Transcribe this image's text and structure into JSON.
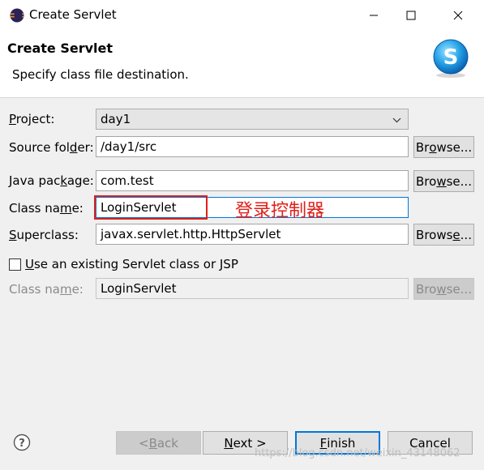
{
  "window": {
    "title": "Create Servlet",
    "icon": "eclipse-icon"
  },
  "header": {
    "title": "Create Servlet",
    "subtitle": "Specify class file destination.",
    "logo": "servlet-s-logo"
  },
  "form": {
    "project": {
      "label": "Project:",
      "value": "day1"
    },
    "source_folder": {
      "label": "Source folder:",
      "value": "/day1/src",
      "button": "Browse..."
    },
    "java_package": {
      "label": "Java package:",
      "value": "com.test",
      "button": "Browse..."
    },
    "class_name": {
      "label": "Class name:",
      "value": "LoginServlet"
    },
    "superclass": {
      "label": "Superclass:",
      "value": "javax.servlet.http.HttpServlet",
      "button": "Browse..."
    },
    "use_existing": {
      "label": "Use an existing Servlet class or JSP",
      "checked": false
    },
    "existing_class_name": {
      "label": "Class name:",
      "value": "LoginServlet",
      "button": "Browse..."
    }
  },
  "annotation": {
    "text": "登录控制器",
    "color": "#e0201a"
  },
  "footer": {
    "help_icon": "help-icon",
    "back": "< Back",
    "next": "Next >",
    "finish": "Finish",
    "cancel": "Cancel"
  },
  "watermark": "https://blog.csdn.net/weixin_43148062",
  "colors": {
    "accent": "#0078d7",
    "background": "#f0f0f0"
  }
}
